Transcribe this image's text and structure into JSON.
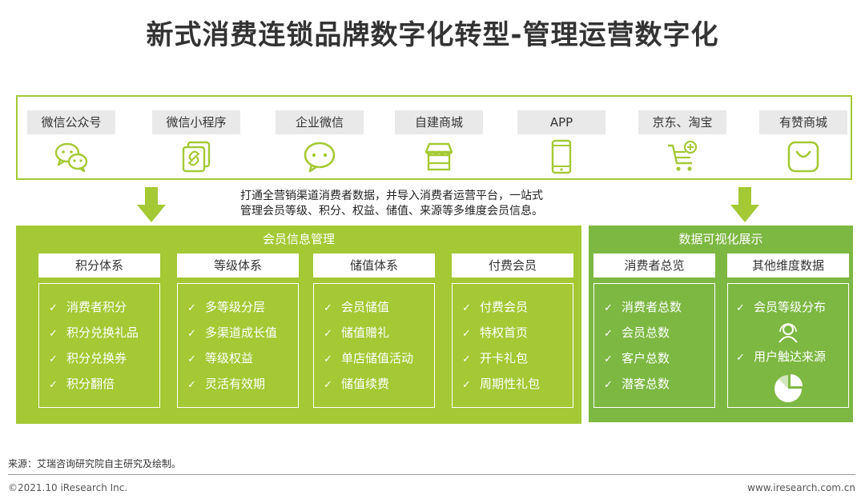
{
  "title": "新式消费连锁品牌数字化转型-管理运营数字化",
  "channels": [
    {
      "label": "微信公众号",
      "icon": "wechat-official-icon"
    },
    {
      "label": "微信小程序",
      "icon": "mini-program-icon"
    },
    {
      "label": "企业微信",
      "icon": "work-wechat-icon"
    },
    {
      "label": "自建商城",
      "icon": "store-icon"
    },
    {
      "label": "APP",
      "icon": "phone-icon"
    },
    {
      "label": "京东、淘宝",
      "icon": "cart-icon"
    },
    {
      "label": "有赞商城",
      "icon": "bag-icon"
    }
  ],
  "description": {
    "line1": "打通全营销渠道消费者数据，并导入消费者运营平台，一站式",
    "line2": "管理会员等级、积分、权益、储值、来源等多维度会员信息。"
  },
  "member": {
    "title": "会员信息管理",
    "columns": [
      {
        "head": "积分体系",
        "items": [
          "消费者积分",
          "积分兑换礼品",
          "积分兑换券",
          "积分翻倍"
        ]
      },
      {
        "head": "等级体系",
        "items": [
          "多等级分层",
          "多渠道成长值",
          "等级权益",
          "灵活有效期"
        ]
      },
      {
        "head": "储值体系",
        "items": [
          "会员储值",
          "储值赠礼",
          "单店储值活动",
          "储值续费"
        ]
      },
      {
        "head": "付费会员",
        "items": [
          "付费会员",
          "特权首页",
          "开卡礼包",
          "周期性礼包"
        ]
      }
    ]
  },
  "viz": {
    "title": "数据可视化展示",
    "columns": [
      {
        "head": "消费者总览",
        "items": [
          "消费者总数",
          "会员总数",
          "客户总数",
          "潜客总数"
        ]
      },
      {
        "head": "其他维度数据",
        "items": [
          "会员等级分布",
          "用户触达来源"
        ]
      }
    ]
  },
  "check_mark": "✓",
  "colors": {
    "accent": "#a4c934",
    "viz": "#7db842",
    "text": "#333333"
  },
  "footer": {
    "source": "来源：艾瑞咨询研究院自主研究及绘制。",
    "copyright": "©2021.10 iResearch Inc.",
    "website": "www.iresearch.com.cn"
  }
}
